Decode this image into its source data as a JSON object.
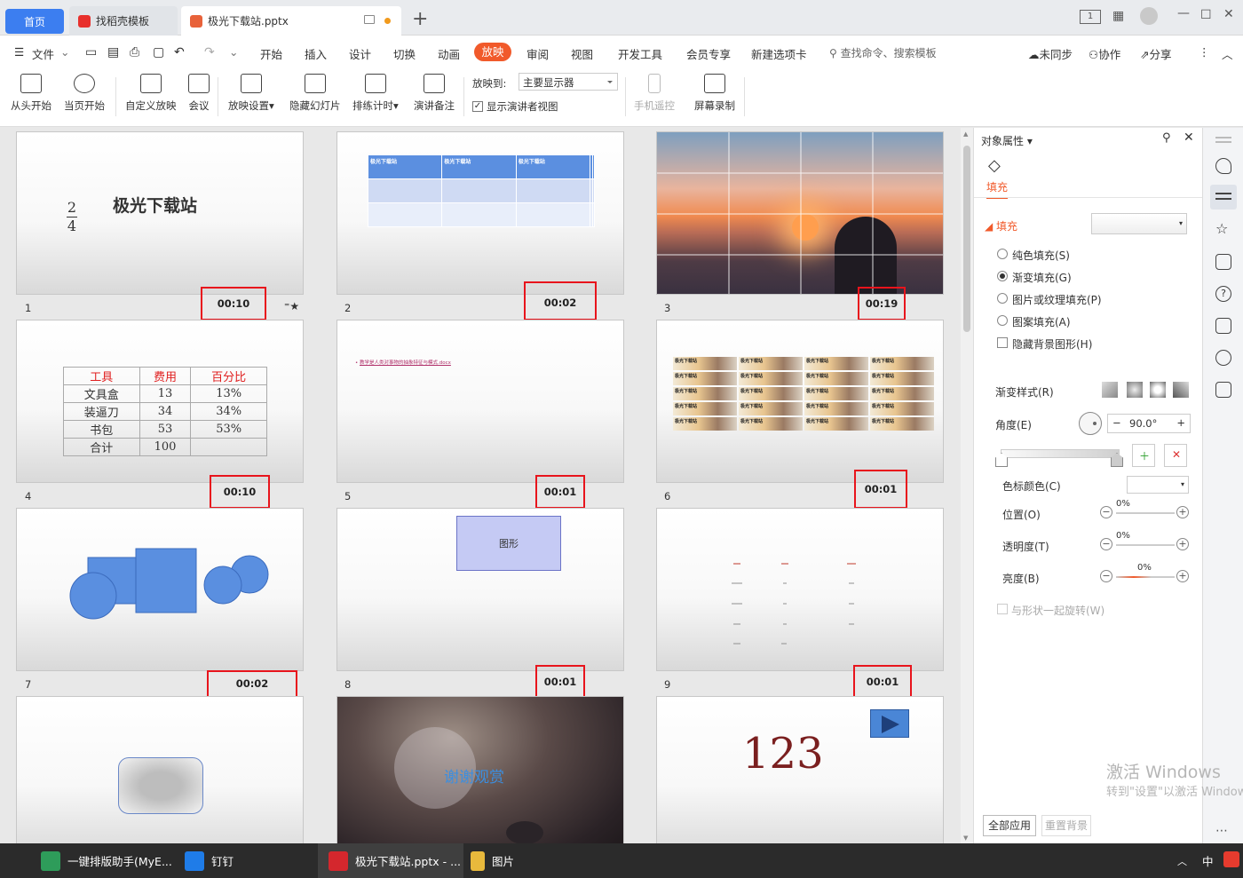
{
  "tabs": {
    "home": "首页",
    "templates": "找稻壳模板",
    "document": "极光下载站.pptx",
    "add": "+"
  },
  "window": {
    "page_indicator": "1"
  },
  "menu": {
    "file": "文件",
    "items": [
      "开始",
      "插入",
      "设计",
      "切换",
      "动画",
      "放映",
      "审阅",
      "视图",
      "开发工具",
      "会员专享",
      "新建选项卡"
    ],
    "active": "放映",
    "search_placeholder": "查找命令、搜索模板",
    "unsynced": "未同步",
    "collab": "协作",
    "share": "分享"
  },
  "ribbon": {
    "from_start": "从头开始",
    "from_current": "当页开始",
    "custom_show": "自定义放映",
    "meeting": "会议",
    "show_settings": "放映设置",
    "hide_slide": "隐藏幻灯片",
    "rehearse": "排练计时",
    "speaker_notes": "演讲备注",
    "show_to_label": "放映到:",
    "monitor": "主要显示器",
    "presenter_view": "显示演讲者视图",
    "remote": "手机遥控",
    "screen_record": "屏幕录制"
  },
  "slides": [
    {
      "num": "1",
      "time": "00:10",
      "title": "极光下载站",
      "fraction_num": "2",
      "fraction_den": "4"
    },
    {
      "num": "2",
      "time": "00:02",
      "headers": [
        "极光下载站",
        "极光下载站",
        "极光下载站"
      ]
    },
    {
      "num": "3",
      "time": "00:19"
    },
    {
      "num": "4",
      "time": "00:10",
      "table": {
        "headers": [
          "工具",
          "费用",
          "百分比"
        ],
        "rows": [
          [
            "文具盒",
            "13",
            "13%"
          ],
          [
            "装逼刀",
            "34",
            "34%"
          ],
          [
            "书包",
            "53",
            "53%"
          ],
          [
            "合计",
            "100",
            ""
          ]
        ]
      }
    },
    {
      "num": "5",
      "time": "00:01",
      "bullet": "教学是人类对事物的抽象特征与模式.docx"
    },
    {
      "num": "6",
      "time": "00:01",
      "tile_label": "极光下载站"
    },
    {
      "num": "7",
      "time": "00:02"
    },
    {
      "num": "8",
      "time": "00:01",
      "shape_text": "图形"
    },
    {
      "num": "9",
      "time": "00:01"
    },
    {
      "num": "10"
    },
    {
      "num": "11",
      "overlay": "谢谢观赏"
    },
    {
      "num": "12",
      "big_text": "123"
    }
  ],
  "panel": {
    "title": "对象属性",
    "tab_fill": "填充",
    "section": "填充",
    "options": [
      "纯色填充(S)",
      "渐变填充(G)",
      "图片或纹理填充(P)",
      "图案填充(A)"
    ],
    "selected_option": "渐变填充(G)",
    "hide_bg": "隐藏背景图形(H)",
    "gradient_style": "渐变样式(R)",
    "angle_label": "角度(E)",
    "angle_value": "90.0°",
    "stop_color": "色标颜色(C)",
    "position": "位置(O)",
    "transparency": "透明度(T)",
    "brightness": "亮度(B)",
    "position_value": "0%",
    "transparency_value": "0%",
    "brightness_value": "0%",
    "rotate_with_shape": "与形状一起旋转(W)",
    "apply_all": "全部应用",
    "reset_bg": "重置背景"
  },
  "watermark": {
    "line1": "激活 Windows",
    "line2": "转到\"设置\"以激活 Windows。"
  },
  "taskbar": {
    "app1": "一键排版助手(MyE...",
    "app2": "钉钉",
    "app3": "极光下载站.pptx - ...",
    "app4": "图片",
    "ime": "中"
  },
  "colors": {
    "accent": "#f15a2b",
    "home_tab": "#3c7ef0",
    "highlight_box": "#e8141c",
    "shape_blue": "#5a8fe0"
  }
}
